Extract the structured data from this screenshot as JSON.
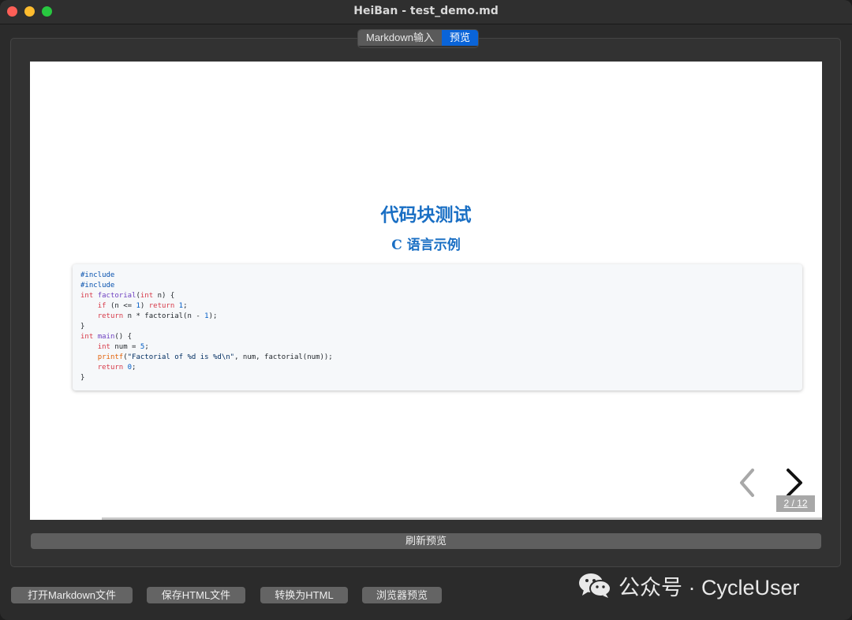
{
  "window": {
    "title": "HeiBan - test_demo.md"
  },
  "tabs": [
    {
      "label": "Markdown输入",
      "active": false
    },
    {
      "label": "预览",
      "active": true
    }
  ],
  "preview": {
    "title": "代码块测试",
    "subtitle": "C 语言示例",
    "page_current": "2",
    "page_separator": "/",
    "page_total": "12"
  },
  "code": {
    "line1": "#include",
    "line2": "#include",
    "line3": {
      "type": "int",
      "name": "factorial",
      "open": "(",
      "ptype": "int",
      "rest": " n) {"
    },
    "line4": {
      "kw": "if",
      "a": " (n <= ",
      "num": "1",
      "b": ") ",
      "ret": "return",
      "num2": "1",
      "end": ";"
    },
    "line5": {
      "ret": "return",
      "a": " n * factorial(n - ",
      "num": "1",
      "end": ");"
    },
    "line6": "}",
    "line7": {
      "type": "int",
      "name": "main",
      "rest": "() {"
    },
    "line8": {
      "type": "int",
      "a": " num = ",
      "num": "5",
      "end": ";"
    },
    "line9": {
      "fn": "printf",
      "open": "(",
      "str": "\"Factorial of %d is %d\\n\"",
      "rest": ", num, factorial(num));"
    },
    "line10": {
      "ret": "return",
      "num": "0",
      "end": ";"
    },
    "line11": "}"
  },
  "buttons": {
    "refresh": "刷新预览",
    "open_markdown": "打开Markdown文件",
    "save_html": "保存HTML文件",
    "convert_html": "转换为HTML",
    "browser_preview": "浏览器预览"
  },
  "watermark": {
    "text": "公众号 · CycleUser",
    "icon": "wechat-icon"
  },
  "colors": {
    "accent": "#0a64d8",
    "heading": "#1a6fc4",
    "close": "#fe5f57",
    "minimize": "#febc2e",
    "maximize": "#28c840"
  }
}
